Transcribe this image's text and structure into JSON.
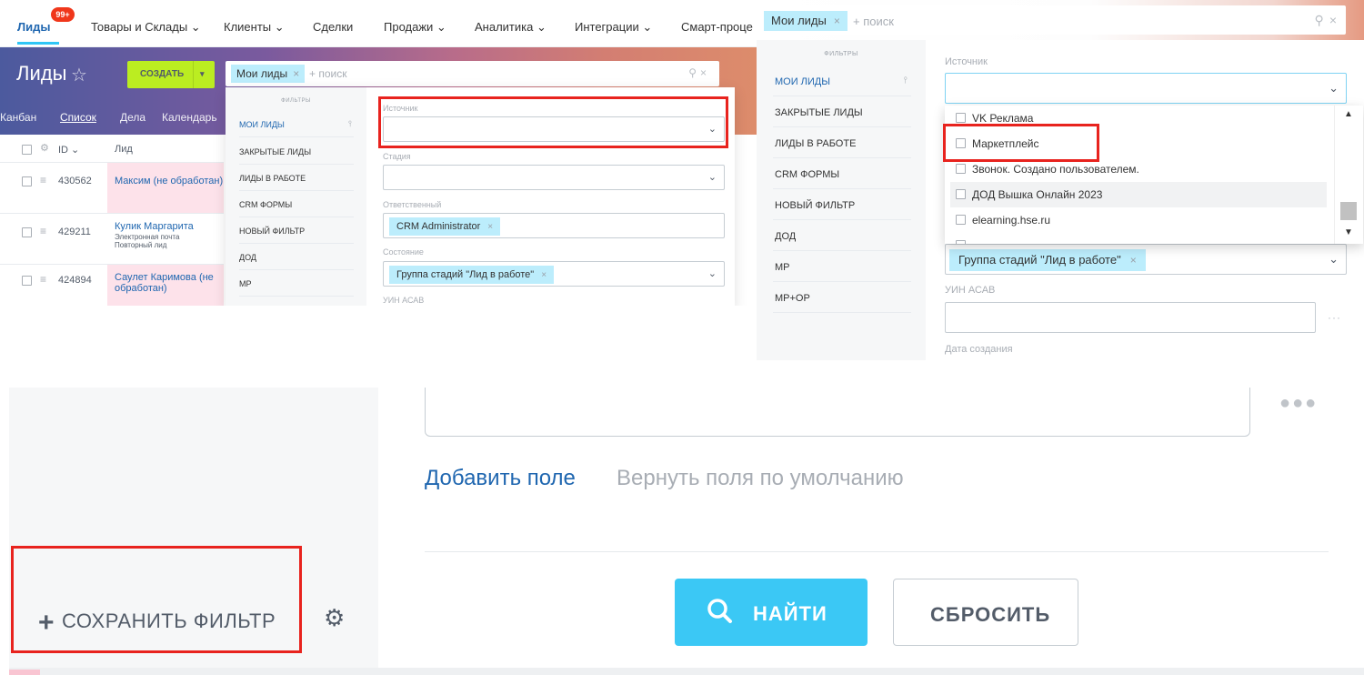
{
  "panel1": {
    "nav": [
      {
        "label": "Лиды",
        "active": true
      },
      {
        "label": "Товары и Склады ⌄"
      },
      {
        "label": "Клиенты ⌄"
      },
      {
        "label": "Сделки"
      },
      {
        "label": "Продажи ⌄"
      },
      {
        "label": "Аналитика ⌄"
      },
      {
        "label": "Интеграции ⌄"
      },
      {
        "label": "Смарт-проце"
      }
    ],
    "badge": "99+",
    "page_title": "Лиды",
    "create_label": "создать",
    "subnav": [
      "Канбан",
      "Список",
      "Дела",
      "Календарь"
    ],
    "list_headers": {
      "id": "ID ⌄",
      "lead": "Лид"
    },
    "rows": [
      {
        "id": "430562",
        "name": "Максим (не обработан)",
        "sub1": "",
        "sub2": "",
        "pink": true
      },
      {
        "id": "429211",
        "name": "Кулик Маргарита",
        "sub1": "Электронная почта",
        "sub2": "Повторный лид",
        "pink": false
      },
      {
        "id": "424894",
        "name": "Саулет Каримова (не",
        "name2": "обработан)",
        "sub1": "",
        "sub2": "",
        "pink": true
      }
    ],
    "search": {
      "tag": "Мои лиды",
      "placeholder": "+ поиск"
    },
    "filters_header": "ФИЛЬТРЫ",
    "filters": [
      "МОИ ЛИДЫ",
      "ЗАКРЫТЫЕ ЛИДЫ",
      "ЛИДЫ В РАБОТЕ",
      "CRM ФОРМЫ",
      "НОВЫЙ ФИЛЬТР",
      "ДОД",
      "МР"
    ],
    "fields": [
      {
        "label": "Источник",
        "value": ""
      },
      {
        "label": "Стадия",
        "value": ""
      },
      {
        "label": "Ответственный",
        "value": "CRM Administrator"
      },
      {
        "label": "Состояние",
        "value": "Группа стадий \"Лид в работе\""
      },
      {
        "label": "УИН АСАВ",
        "value": ""
      }
    ]
  },
  "panel2": {
    "search": {
      "tag": "Мои лиды",
      "placeholder": "+ поиск"
    },
    "filters_header": "ФИЛЬТРЫ",
    "filters": [
      "МОИ ЛИДЫ",
      "ЗАКРЫТЫЕ ЛИДЫ",
      "ЛИДЫ В РАБОТЕ",
      "CRM ФОРМЫ",
      "НОВЫЙ ФИЛЬТР",
      "ДОД",
      "МР",
      "МР+ОР"
    ],
    "source_label": "Источник",
    "options": [
      "VK Реклама",
      "Маркетплейс",
      "Звонок. Создано пользователем.",
      "ДОД Вышка Онлайн 2023",
      "elearning.hse.ru"
    ],
    "state_value": "Группа стадий \"Лид в работе\"",
    "uin_label": "УИН АСАВ",
    "date_label": "Дата создания",
    "more": "···"
  },
  "panel3": {
    "more": "●●●",
    "add_field": "Добавить поле",
    "reset_fields": "Вернуть поля по умолчанию",
    "find": "НАЙТИ",
    "reset": "СБРОСИТЬ",
    "save_filter": "СОХРАНИТЬ ФИЛЬТР",
    "plus": "+",
    "gear": "⚙"
  },
  "colors": {
    "accent": "#2fc6f6",
    "link": "#2067b0",
    "highlight": "#e8231e",
    "create": "#bbed21"
  }
}
